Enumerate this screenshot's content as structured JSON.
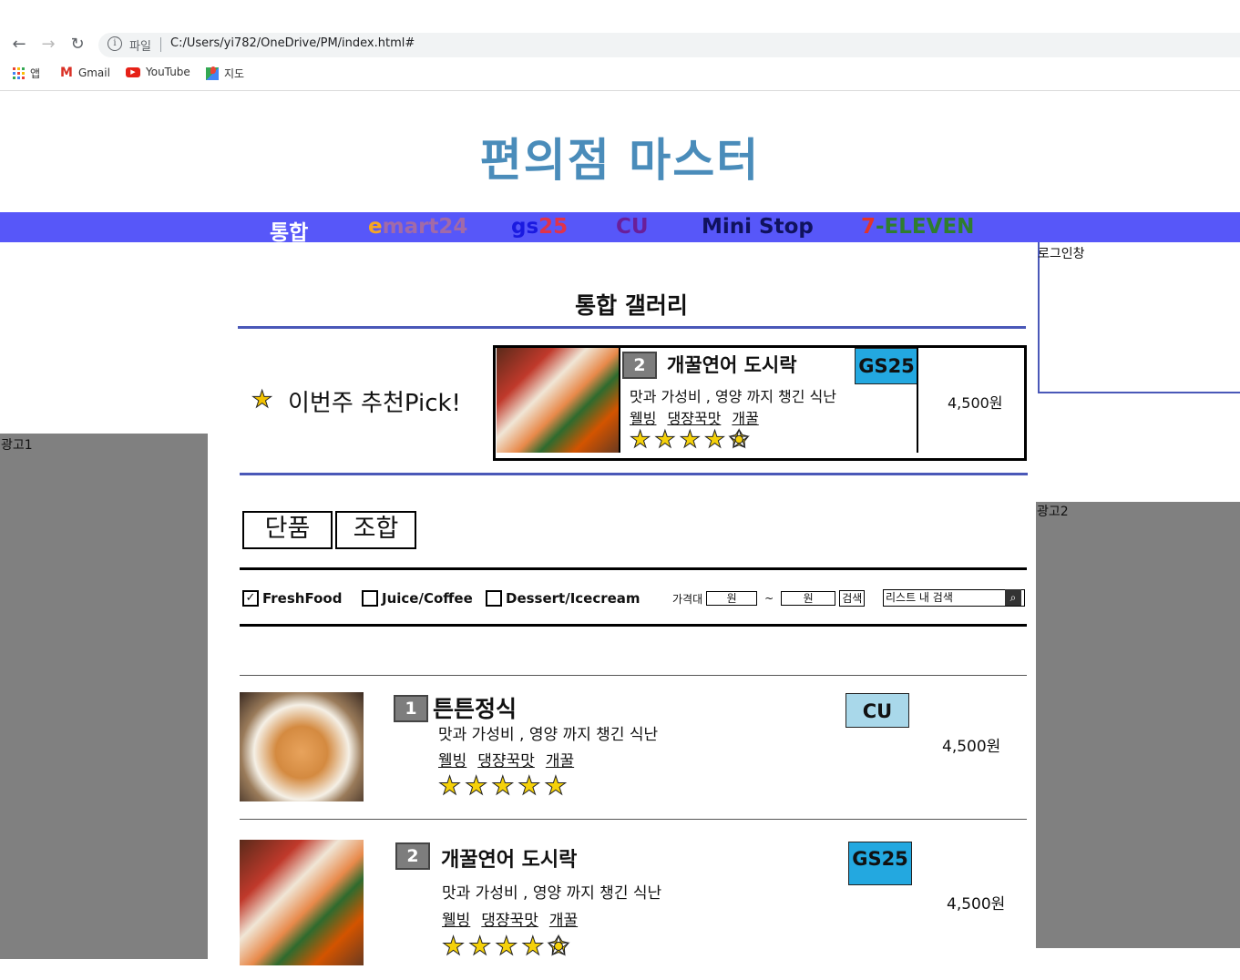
{
  "browser": {
    "url_scheme": "파일",
    "url": "C:/Users/yi782/OneDrive/PM/index.html#",
    "bookmarks": [
      {
        "label": "앱",
        "icon": "apps-grid-icon"
      },
      {
        "label": "Gmail",
        "icon": "gmail-icon"
      },
      {
        "label": "YouTube",
        "icon": "youtube-icon"
      },
      {
        "label": "지도",
        "icon": "maps-icon"
      }
    ]
  },
  "site": {
    "title": "편의점 마스터",
    "nav": {
      "all": "통합",
      "emart_a": "e",
      "emart_b": "mart24",
      "gs_a": "gs",
      "gs_b": "25",
      "cu": "CU",
      "ministop": "Mini Stop",
      "seven_a": "7",
      "seven_b": "-ELEVEN"
    },
    "colors": {
      "navbar": "#5757f9",
      "title": "#4a8cba",
      "gs25_badge": "#23a8e0",
      "cu_badge": "#a9d8ea"
    }
  },
  "login": {
    "label": "로그인창"
  },
  "ads": {
    "left": "광고1",
    "right": "광고2"
  },
  "gallery": {
    "title": "통합 갤러리",
    "pick_label": "이번주 추천Pick!",
    "pick": {
      "rank": "2",
      "name": "개꿀연어 도시락",
      "brand": "GS25",
      "desc": "맛과 가성비 , 영양 까지 챙긴 식난",
      "tags": [
        "웰빙",
        "댕쟝꾹맛",
        "개꿀"
      ],
      "rating": 4.5,
      "price": "4,500원"
    }
  },
  "tabs": {
    "single": "단품",
    "combo": "조합"
  },
  "filters": {
    "categories": [
      {
        "label": "FreshFood",
        "checked": true
      },
      {
        "label": "Juice/Coffee",
        "checked": false
      },
      {
        "label": "Dessert/Icecream",
        "checked": false
      }
    ],
    "price_label": "가격대",
    "min_unit": "원",
    "tilde": "~",
    "max_unit": "원",
    "search_btn": "검색",
    "list_search_placeholder": "리스트 내 검색"
  },
  "items": [
    {
      "rank": "1",
      "name": "튼튼정식",
      "brand": "CU",
      "desc": "맛과 가성비 , 영양 까지 챙긴 식난",
      "tags": [
        "웰빙",
        "댕쟝꾹맛",
        "개꿀"
      ],
      "rating": 5,
      "price": "4,500원"
    },
    {
      "rank": "2",
      "name": "개꿀연어 도시락",
      "brand": "GS25",
      "desc": "맛과 가성비 , 영양 까지 챙긴 식난",
      "tags": [
        "웰빙",
        "댕쟝꾹맛",
        "개꿀"
      ],
      "rating": 4.5,
      "price": "4,500원"
    }
  ]
}
